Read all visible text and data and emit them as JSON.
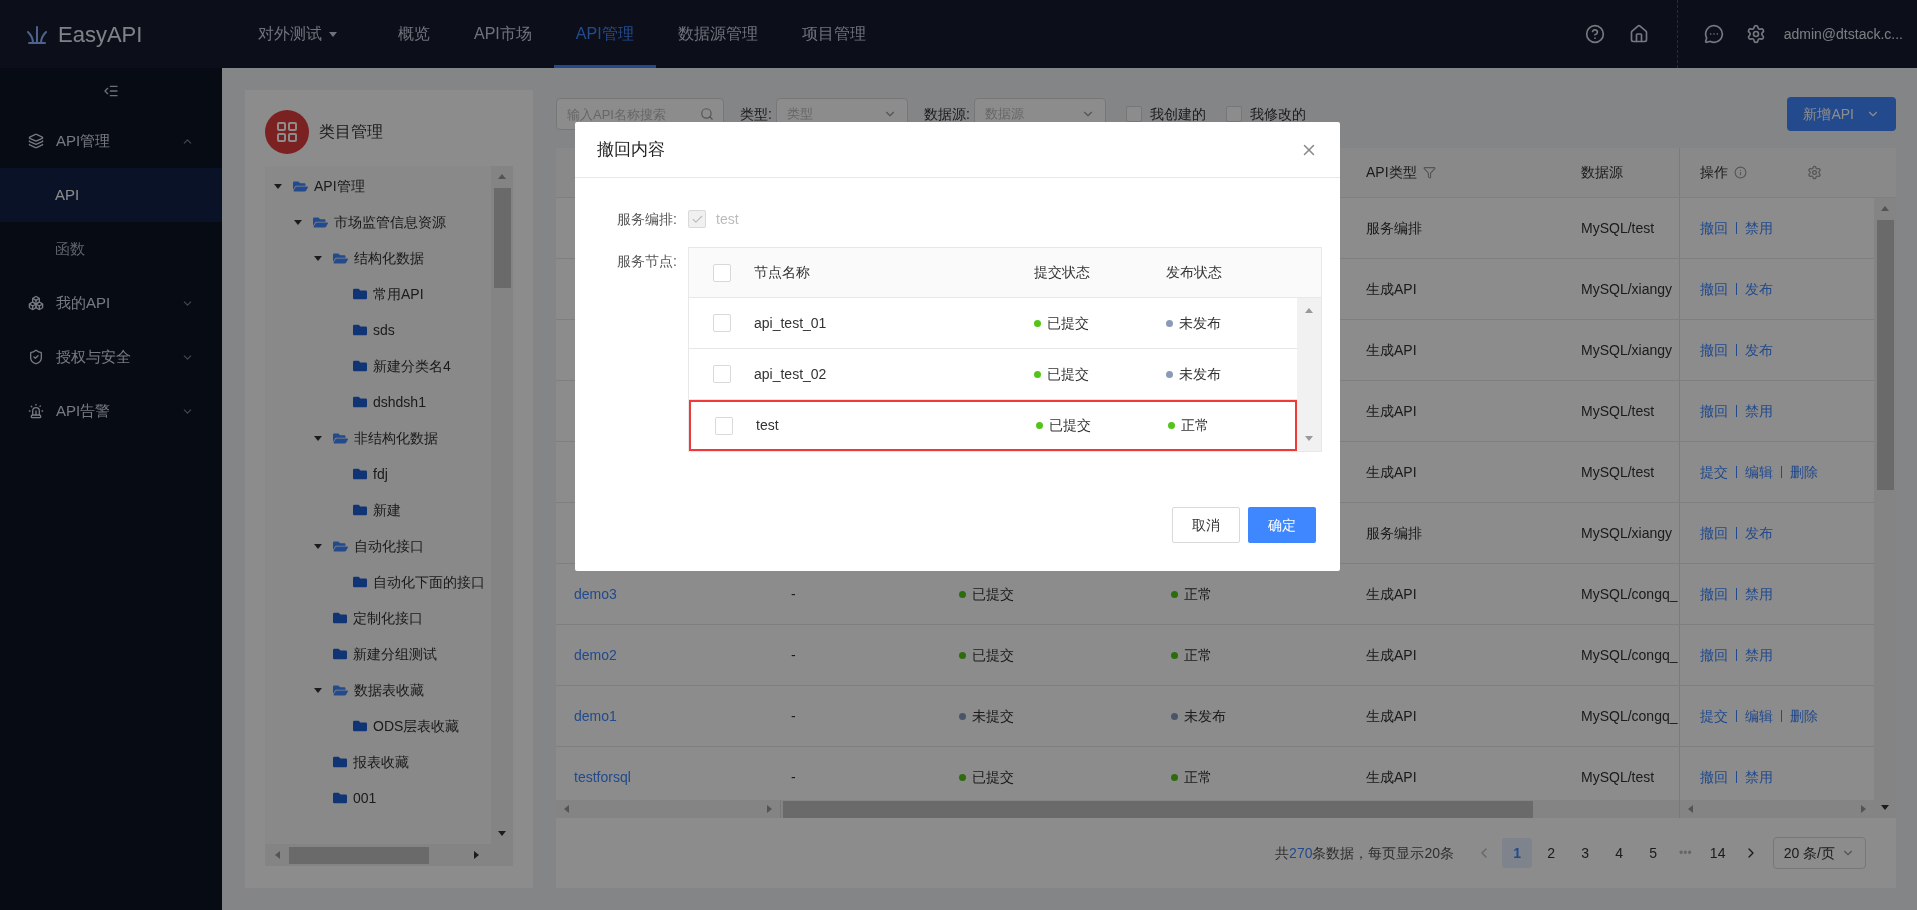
{
  "topbar": {
    "logo": "EasyAPI",
    "project": "对外测试",
    "nav": [
      {
        "label": "概览",
        "selected": false
      },
      {
        "label": "API市场",
        "selected": false
      },
      {
        "label": "API管理",
        "selected": true
      },
      {
        "label": "数据源管理",
        "selected": false
      },
      {
        "label": "项目管理",
        "selected": false
      }
    ],
    "user": "admin@dtstack.c..."
  },
  "sidebar": {
    "items": [
      {
        "label": "API管理",
        "expanded": true,
        "children": [
          {
            "label": "API",
            "selected": true
          },
          {
            "label": "函数",
            "selected": false
          }
        ]
      },
      {
        "label": "我的API",
        "expanded": false
      },
      {
        "label": "授权与安全",
        "expanded": false
      },
      {
        "label": "API告警",
        "expanded": false
      }
    ]
  },
  "category_panel": {
    "title": "类目管理",
    "tree": [
      {
        "label": "API管理",
        "expanded": true,
        "children": [
          {
            "label": "市场监管信息资源",
            "expanded": true,
            "children": [
              {
                "label": "结构化数据",
                "expanded": true,
                "children": [
                  {
                    "label": "常用API"
                  },
                  {
                    "label": "sds"
                  },
                  {
                    "label": "新建分类名4"
                  },
                  {
                    "label": "dshdsh1"
                  }
                ]
              },
              {
                "label": "非结构化数据",
                "expanded": true,
                "children": [
                  {
                    "label": "fdj"
                  },
                  {
                    "label": "新建"
                  }
                ]
              },
              {
                "label": "自动化接口",
                "expanded": true,
                "children": [
                  {
                    "label": "自动化下面的接口"
                  }
                ]
              },
              {
                "label": "定制化接口"
              },
              {
                "label": "新建分组测试"
              },
              {
                "label": "数据表收藏",
                "expanded": true,
                "children": [
                  {
                    "label": "ODS层表收藏"
                  }
                ]
              },
              {
                "label": "报表收藏"
              },
              {
                "label": "001"
              }
            ]
          }
        ]
      }
    ]
  },
  "toolbar": {
    "search": {
      "placeholder": "输入API名称搜索"
    },
    "type_label": "类型:",
    "type_select": {
      "placeholder": "类型"
    },
    "source_label": "数据源:",
    "source_select": {
      "placeholder": "数据源"
    },
    "filters": [
      {
        "label": "我创建的",
        "checked": false
      },
      {
        "label": "我修改的",
        "checked": false
      }
    ],
    "add_button": "新增API"
  },
  "table": {
    "columns": [
      {
        "label": "API类型",
        "kind": "filter"
      },
      {
        "label": "数据源",
        "kind": "plain"
      },
      {
        "label": "操作",
        "kind": "info"
      }
    ],
    "rows": [
      {
        "api_type": "服务编排",
        "source": "MySQL/test",
        "actions": [
          "撤回",
          "禁用"
        ]
      },
      {
        "api_type": "生成API",
        "source": "MySQL/xiangy",
        "actions": [
          "撤回",
          "发布"
        ]
      },
      {
        "api_type": "生成API",
        "source": "MySQL/xiangy",
        "actions": [
          "撤回",
          "发布"
        ]
      },
      {
        "api_type": "生成API",
        "source": "MySQL/test",
        "actions": [
          "撤回",
          "禁用"
        ]
      },
      {
        "api_type": "生成API",
        "source": "MySQL/test",
        "actions": [
          "提交",
          "编辑",
          "删除"
        ]
      },
      {
        "api_type": "服务编排",
        "source": "MySQL/xiangy",
        "actions": [
          "撤回",
          "发布"
        ]
      },
      {
        "name": "demo3",
        "description": "-",
        "submit": {
          "text": "已提交",
          "color": "#2d6c0e"
        },
        "publish": {
          "text": "正常",
          "color": "#2d6c0e"
        },
        "api_type": "生成API",
        "source": "MySQL/congq_",
        "actions": [
          "撤回",
          "禁用"
        ]
      },
      {
        "name": "demo2",
        "description": "-",
        "submit": {
          "text": "已提交",
          "color": "#2d6c0e"
        },
        "publish": {
          "text": "正常",
          "color": "#2d6c0e"
        },
        "api_type": "生成API",
        "source": "MySQL/congq_",
        "actions": [
          "撤回",
          "禁用"
        ]
      },
      {
        "name": "demo1",
        "description": "-",
        "submit": {
          "text": "未提交",
          "color": "#4c5565"
        },
        "publish": {
          "text": "未发布",
          "color": "#4c5565"
        },
        "api_type": "生成API",
        "source": "MySQL/congq_",
        "actions": [
          "提交",
          "编辑",
          "删除"
        ]
      },
      {
        "name": "testforsql",
        "description": "-",
        "submit": {
          "text": "已提交",
          "color": "#2d6c0e"
        },
        "publish": {
          "text": "正常",
          "color": "#2d6c0e"
        },
        "api_type": "生成API",
        "source": "MySQL/test",
        "actions": [
          "撤回",
          "禁用"
        ]
      }
    ]
  },
  "pagination": {
    "summary_prefix": "共",
    "summary_count": "270",
    "summary_suffix": "条数据，每页显示20条",
    "pages": [
      {
        "label": "1",
        "kind": "page",
        "selected": true
      },
      {
        "label": "2",
        "kind": "page",
        "selected": false
      },
      {
        "label": "3",
        "kind": "page",
        "selected": false
      },
      {
        "label": "4",
        "kind": "page",
        "selected": false
      },
      {
        "label": "5",
        "kind": "page",
        "selected": false
      },
      {
        "label": "•••",
        "kind": "ellipsis",
        "selected": false
      },
      {
        "label": "14",
        "kind": "page",
        "selected": false
      }
    ],
    "page_size": "20 条/页"
  },
  "dialog": {
    "title": "撤回内容",
    "orchestration_label": "服务编排:",
    "orchestration": {
      "label": "test",
      "checked": true,
      "disabled": true
    },
    "nodes_label": "服务节点:",
    "select_all_checked": false,
    "columns": [
      "节点名称",
      "提交状态",
      "发布状态"
    ],
    "nodes": [
      {
        "name": "api_test_01",
        "checked": false,
        "highlighted": false,
        "submit": {
          "text": "已提交",
          "color": "#52c41a"
        },
        "publish": {
          "text": "未发布",
          "color": "#8a9ab8"
        }
      },
      {
        "name": "api_test_02",
        "checked": false,
        "highlighted": false,
        "submit": {
          "text": "已提交",
          "color": "#52c41a"
        },
        "publish": {
          "text": "未发布",
          "color": "#8a9ab8"
        }
      },
      {
        "name": "test",
        "checked": false,
        "highlighted": true,
        "submit": {
          "text": "已提交",
          "color": "#52c41a"
        },
        "publish": {
          "text": "正常",
          "color": "#52c41a"
        }
      }
    ],
    "cancel": "取消",
    "confirm": "确定"
  }
}
